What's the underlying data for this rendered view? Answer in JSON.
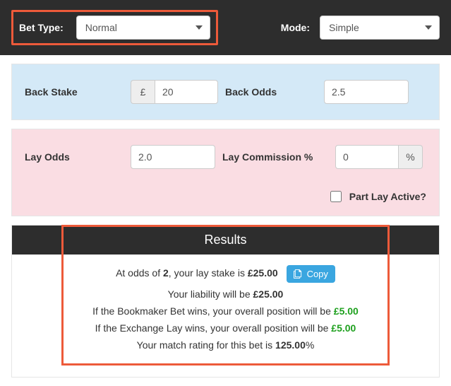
{
  "topbar": {
    "bet_type_label": "Bet Type:",
    "bet_type_value": "Normal",
    "mode_label": "Mode:",
    "mode_value": "Simple"
  },
  "back": {
    "stake_label": "Back Stake",
    "currency": "£",
    "stake_value": "20",
    "odds_label": "Back Odds",
    "odds_value": "2.5"
  },
  "lay": {
    "odds_label": "Lay Odds",
    "odds_value": "2.0",
    "commission_label": "Lay Commission %",
    "commission_value": "0",
    "percent": "%",
    "part_lay_label": "Part Lay Active?"
  },
  "results": {
    "header": "Results",
    "line1_pre": "At odds of ",
    "line1_odds": "2",
    "line1_mid": ", your lay stake is ",
    "line1_stake": "£25.00",
    "copy_label": "Copy",
    "line2_pre": "Your liability will be ",
    "line2_val": "£25.00",
    "line3_pre": "If the Bookmaker Bet wins, your overall position will be ",
    "line3_val": "£5.00",
    "line4_pre": "If the Exchange Lay wins, your overall position will be ",
    "line4_val": "£5.00",
    "line5_pre": "Your match rating for this bet is ",
    "line5_val": "125.00",
    "line5_suf": "%"
  }
}
